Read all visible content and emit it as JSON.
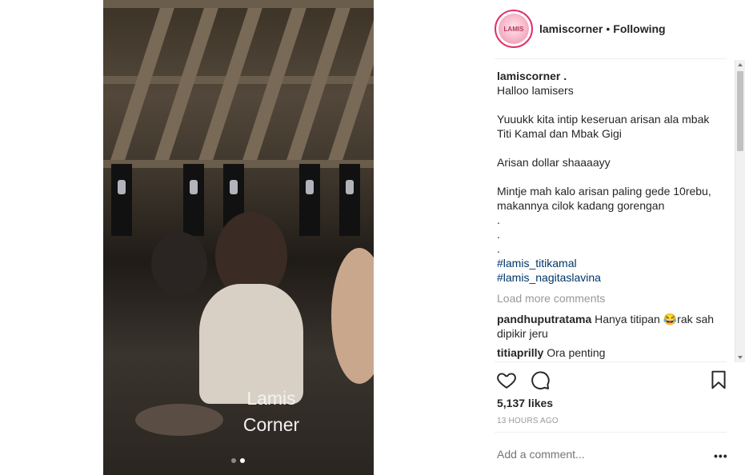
{
  "post": {
    "username": "lamiscorner",
    "separator": "•",
    "follow_status": "Following",
    "avatar_text": "LAMIS"
  },
  "media": {
    "overlay_line1": "Lamis",
    "overlay_line2": "Corner",
    "carousel_count": 2,
    "carousel_active": 2
  },
  "caption": {
    "author": "lamiscorner .",
    "lines": [
      "Halloo lamisers",
      "",
      "Yuuukk kita intip keseruan arisan ala mbak",
      "Titi Kamal dan Mbak Gigi",
      "",
      "Arisan dollar shaaaayy",
      "",
      "Mintje mah kalo arisan paling gede 10rebu,",
      "makannya cilok kadang gorengan",
      ".",
      ".",
      "."
    ],
    "hashtags": [
      "#lamis_titikamal",
      "#lamis_nagitaslavina"
    ]
  },
  "comments": {
    "load_more": "Load more comments",
    "items": [
      {
        "user": "pandhuputratama",
        "text": "Hanya titipan 😂rak sah dipikir jeru"
      },
      {
        "user": "titiaprilly",
        "text": "Ora penting"
      }
    ]
  },
  "actions": {
    "like_icon": "heart-icon",
    "comment_icon": "comment-bubble-icon",
    "save_icon": "bookmark-icon"
  },
  "likes_text": "5,137 likes",
  "timestamp": "13 HOURS AGO",
  "comment_placeholder": "Add a comment...",
  "more_options": "•••",
  "colors": {
    "hashtag": "#003569",
    "muted": "#999999",
    "avatar_ring": "#e1306c"
  }
}
